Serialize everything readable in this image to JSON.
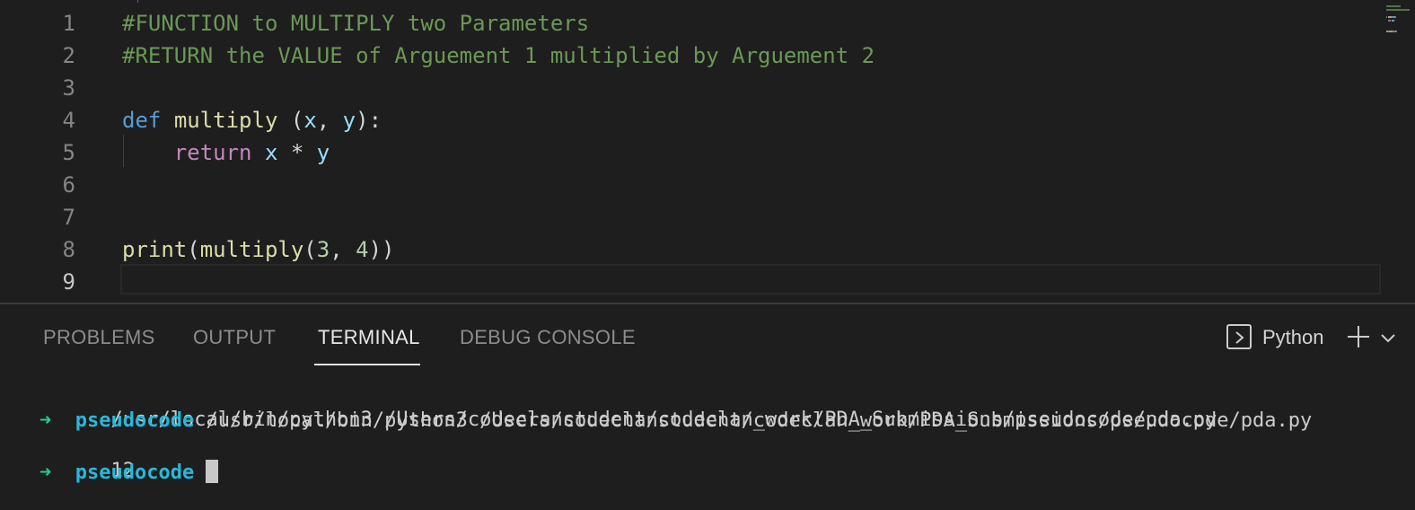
{
  "editor": {
    "top_fragment": "))",
    "lines": [
      {
        "number": "1",
        "tokens": [
          {
            "text": "#FUNCTION to MULTIPLY two Parameters",
            "cls": "tok-comment"
          }
        ]
      },
      {
        "number": "2",
        "tokens": [
          {
            "text": "#RETURN the VALUE of Arguement 1 multiplied by Arguement 2",
            "cls": "tok-comment"
          }
        ]
      },
      {
        "number": "3",
        "tokens": []
      },
      {
        "number": "4",
        "tokens": [
          {
            "text": "def",
            "cls": "tok-keyword"
          },
          {
            "text": " ",
            "cls": "tok-plain"
          },
          {
            "text": "multiply",
            "cls": "tok-func"
          },
          {
            "text": " (",
            "cls": "tok-plain"
          },
          {
            "text": "x",
            "cls": "tok-var"
          },
          {
            "text": ", ",
            "cls": "tok-plain"
          },
          {
            "text": "y",
            "cls": "tok-var"
          },
          {
            "text": "):",
            "cls": "tok-plain"
          }
        ]
      },
      {
        "number": "5",
        "tokens": [
          {
            "text": "    ",
            "cls": "tok-plain"
          },
          {
            "text": "return",
            "cls": "tok-control"
          },
          {
            "text": " ",
            "cls": "tok-plain"
          },
          {
            "text": "x",
            "cls": "tok-var"
          },
          {
            "text": " * ",
            "cls": "tok-plain"
          },
          {
            "text": "y",
            "cls": "tok-var"
          }
        ]
      },
      {
        "number": "6",
        "tokens": []
      },
      {
        "number": "7",
        "tokens": []
      },
      {
        "number": "8",
        "tokens": [
          {
            "text": "print",
            "cls": "tok-func"
          },
          {
            "text": "(",
            "cls": "tok-plain"
          },
          {
            "text": "multiply",
            "cls": "tok-func"
          },
          {
            "text": "(",
            "cls": "tok-plain"
          },
          {
            "text": "3",
            "cls": "tok-num"
          },
          {
            "text": ", ",
            "cls": "tok-plain"
          },
          {
            "text": "4",
            "cls": "tok-num"
          },
          {
            "text": "))",
            "cls": "tok-plain"
          }
        ]
      },
      {
        "number": "9",
        "tokens": []
      }
    ],
    "active_line": "9"
  },
  "panel": {
    "tabs": [
      {
        "label": "PROBLEMS",
        "active": false
      },
      {
        "label": "OUTPUT",
        "active": false
      },
      {
        "label": "TERMINAL",
        "active": true
      },
      {
        "label": "DEBUG CONSOLE",
        "active": false
      }
    ],
    "terminal_name": "Python",
    "icons": {
      "terminal": "terminal-icon",
      "add": "plus-icon",
      "dropdown": "chevron-down-icon"
    }
  },
  "terminal": {
    "lines": [
      {
        "kind": "plain",
        "text": "/usr/local/bin/python3 /Users/codeclanstudent/codeclan_work/PDA_Submissions/pseudocode/pda.py"
      },
      {
        "kind": "prompt",
        "arrow": "➜",
        "dir": "pseudocode",
        "command": " /usr/local/bin/python3 /Users/codeclanstudent/codeclan_work/PDA_Submissions/pseudocode/pda.py"
      },
      {
        "kind": "plain",
        "text": "12"
      },
      {
        "kind": "prompt-cursor",
        "arrow": "➜",
        "dir": "pseudocode",
        "command": " "
      }
    ]
  },
  "colors": {
    "background": "#1e1e1e",
    "comment": "#6a9955",
    "keyword": "#569cd6",
    "control": "#c586c0",
    "function": "#dcdcaa",
    "variable": "#9cdcfe",
    "number": "#b5cea8",
    "prompt_arrow": "#23d18b",
    "prompt_dir": "#29b8db"
  }
}
